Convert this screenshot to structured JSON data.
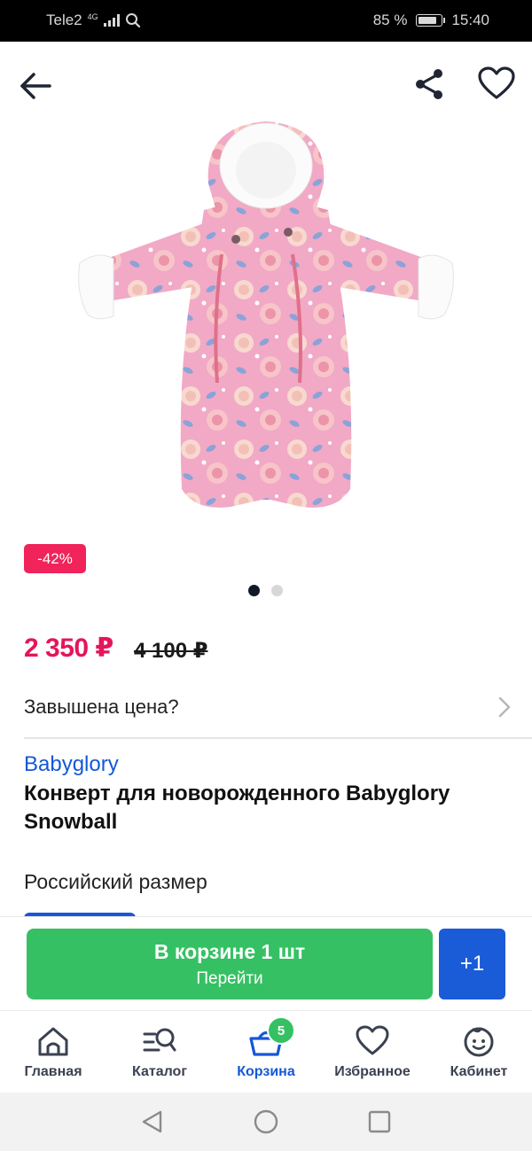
{
  "status_bar": {
    "carrier": "Tele2",
    "network": "4G",
    "battery_percent": "85 %",
    "battery_level": 0.85,
    "time": "15:40"
  },
  "top_bar": {
    "back_icon": "arrow-left-icon",
    "share_icon": "share-icon",
    "favorite_icon": "heart-outline-icon"
  },
  "product": {
    "image_icon": "pink-floral-baby-snowsuit-image",
    "discount": "-42%",
    "carousel": {
      "count": 2,
      "active_index": 0
    },
    "price": "2 350 ₽",
    "old_price": "4 100 ₽",
    "inflated_price_label": "Завышена цена?",
    "brand": "Babyglory",
    "title": "Конверт для новорожденного Babyglory Snowball",
    "size_label": "Российский размер"
  },
  "cart_bar": {
    "in_cart_label": "В корзине 1 шт",
    "go_label": "Перейти",
    "plus_label": "+1"
  },
  "tabs": [
    {
      "label": "Главная",
      "icon": "home-icon"
    },
    {
      "label": "Каталог",
      "icon": "catalog-search-icon"
    },
    {
      "label": "Корзина",
      "icon": "basket-icon",
      "badge": "5",
      "active": true
    },
    {
      "label": "Избранное",
      "icon": "heart-icon"
    },
    {
      "label": "Кабинет",
      "icon": "profile-face-icon"
    }
  ],
  "colors": {
    "accent_blue": "#1458d6",
    "price_red": "#e4155b",
    "cart_green": "#35c163",
    "plus_blue": "#1a5bd8"
  }
}
